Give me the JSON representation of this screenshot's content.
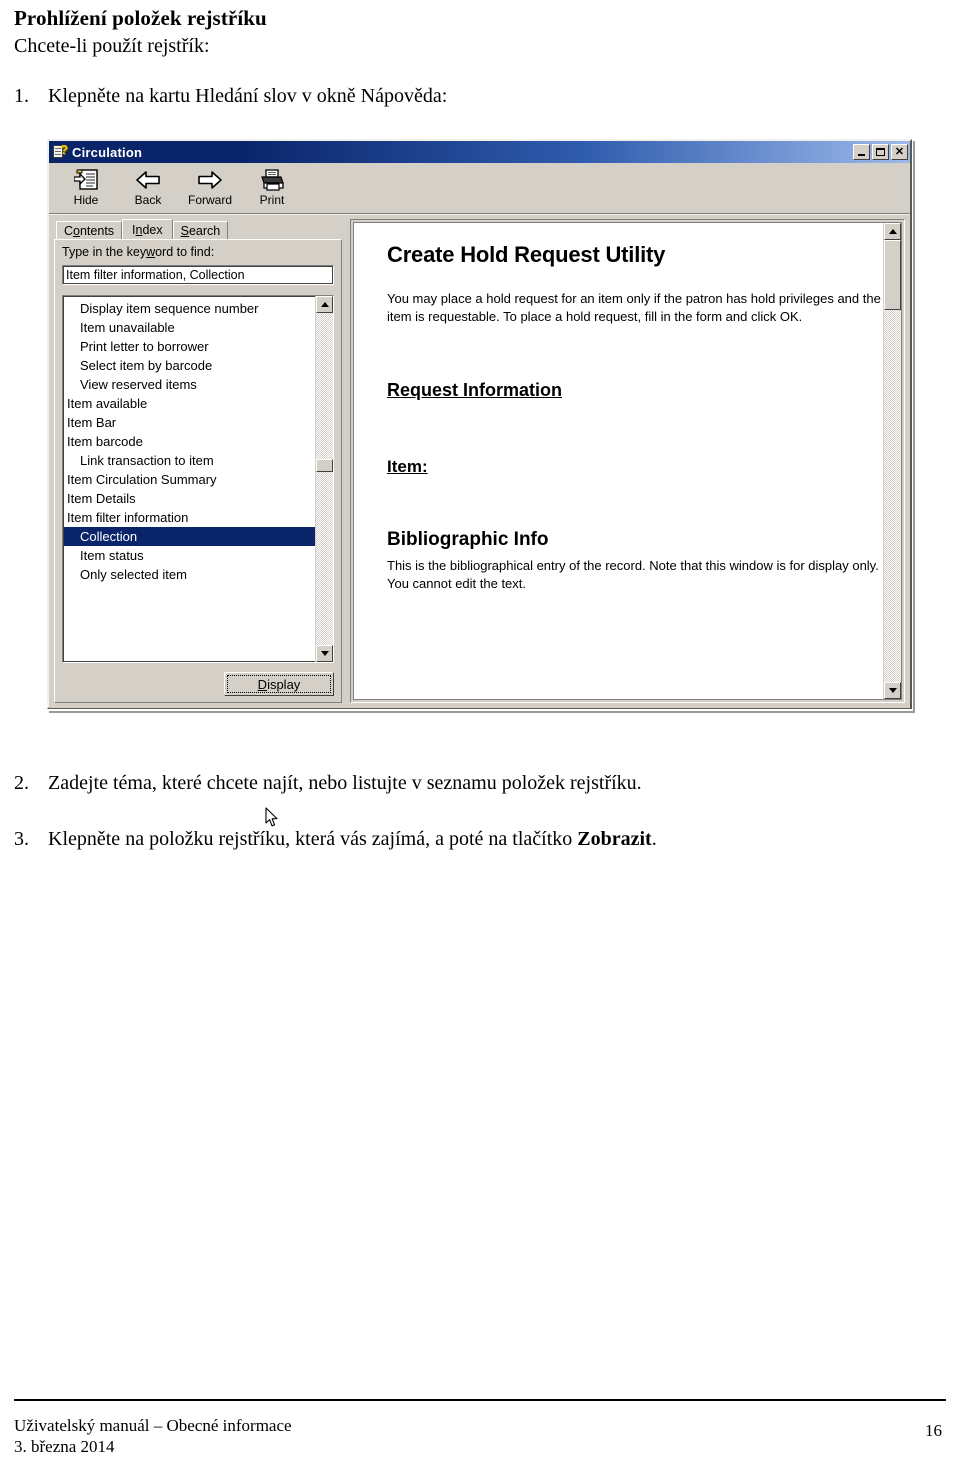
{
  "document": {
    "heading": "Prohlížení položek rejstříku",
    "subheading": "Chcete-li použít rejstřík:",
    "steps": [
      {
        "num": "1.",
        "text": "Klepněte na kartu Hledání slov v okně Nápověda:"
      },
      {
        "num": "2.",
        "text": "Zadejte téma, které chcete najít, nebo listujte v seznamu položek rejstříku."
      },
      {
        "num": "3.",
        "pre": "Klepněte na položku rejstříku, která vás zajímá, a poté na tlačítko ",
        "bold": "Zobrazit",
        "post": "."
      }
    ],
    "footer": {
      "line1": "Uživatelský manuál – Obecné informace",
      "line2": "3. března 2014",
      "page": "16"
    }
  },
  "screenshot": {
    "window": {
      "title": "Circulation",
      "icon": "help-document-icon",
      "buttons": {
        "minimize": "minimize-button",
        "maximize": "maximize-button",
        "close": "close-button"
      },
      "titlebar_color": "#0a246a"
    },
    "toolbar": {
      "items": [
        {
          "label": "Hide",
          "icon": "hide-pane-icon"
        },
        {
          "label": "Back",
          "icon": "arrow-left-icon"
        },
        {
          "label": "Forward",
          "icon": "arrow-right-icon"
        },
        {
          "label": "Print",
          "icon": "printer-icon"
        }
      ]
    },
    "nav": {
      "tabs": [
        {
          "label_before": "C",
          "accel": "o",
          "label_after": "ntents",
          "active": false
        },
        {
          "label_before": "I",
          "accel": "n",
          "label_after": "dex",
          "active": true
        },
        {
          "label_before": "",
          "accel": "S",
          "label_after": "earch",
          "active": false
        }
      ],
      "keyword_label_before": "Type in the key",
      "keyword_label_accel": "w",
      "keyword_label_after": "ord to find:",
      "keyword_value": "Item filter information, Collection",
      "keyword_placeholder": "",
      "list_items": [
        {
          "label": "Display item sequence number",
          "indent": true,
          "selected": false
        },
        {
          "label": "Item unavailable",
          "indent": true,
          "selected": false
        },
        {
          "label": "Print letter to borrower",
          "indent": true,
          "selected": false
        },
        {
          "label": "Select item by barcode",
          "indent": true,
          "selected": false
        },
        {
          "label": "View reserved items",
          "indent": true,
          "selected": false
        },
        {
          "label": "Item available",
          "indent": false,
          "selected": false
        },
        {
          "label": "Item Bar",
          "indent": false,
          "selected": false
        },
        {
          "label": "Item barcode",
          "indent": false,
          "selected": false
        },
        {
          "label": "Link transaction to item",
          "indent": true,
          "selected": false
        },
        {
          "label": "Item Circulation Summary",
          "indent": false,
          "selected": false
        },
        {
          "label": "Item Details",
          "indent": false,
          "selected": false
        },
        {
          "label": "Item filter information",
          "indent": false,
          "selected": false
        },
        {
          "label": "Collection",
          "indent": true,
          "selected": true
        },
        {
          "label": "Item status",
          "indent": true,
          "selected": false
        },
        {
          "label": "Only selected item",
          "indent": true,
          "selected": false
        }
      ],
      "display_button_accel": "D",
      "display_button_rest": "isplay",
      "scrollbar": {
        "up": "scroll-up-arrow",
        "down": "scroll-down-arrow",
        "thumb_pct": 45
      }
    },
    "content": {
      "title": "Create Hold Request Utility",
      "intro": "You may place a hold request for an item only if the patron has hold privileges and the item is requestable. To place a hold request, fill in the form and click OK.",
      "section_request": "Request Information",
      "section_item": "Item:",
      "section_biblio": "Bibliographic Info",
      "biblio_text": "This is the bibliographical entry of the record. Note that this window is for display only. You cannot edit the text.",
      "scrollbar": {
        "up": "scroll-up-arrow",
        "down": "scroll-down-arrow",
        "thumb_pct": 2
      }
    }
  }
}
